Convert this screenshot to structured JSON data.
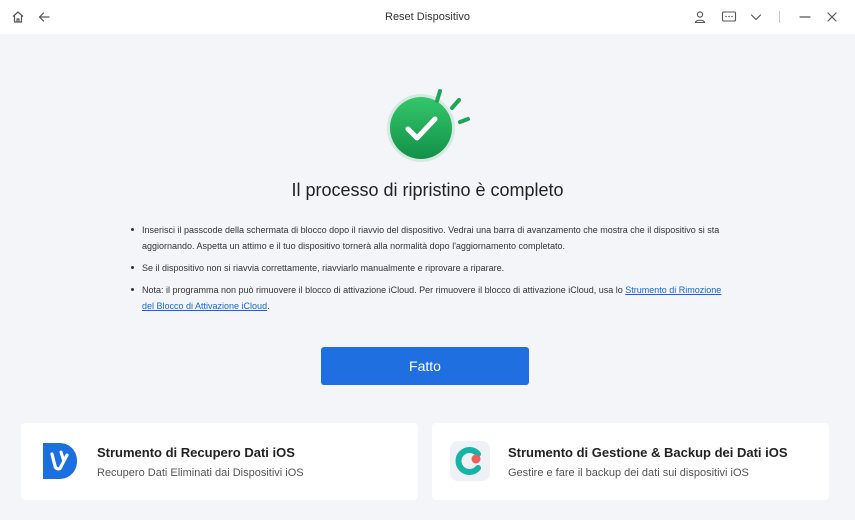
{
  "window": {
    "title": "Reset Dispositivo",
    "icons": [
      "home-icon",
      "back-arrow-icon",
      "user-icon",
      "message-icon",
      "chevron-down-icon",
      "minimize-icon",
      "close-icon"
    ]
  },
  "main": {
    "heading": "Il processo di ripristino è completo",
    "notes": [
      {
        "text": "Inserisci il passcode della schermata di blocco dopo il riavvio del dispositivo. Vedrai una barra di avanzamento che mostra che il dispositivo si sta aggiornando. Aspetta un attimo e il tuo dispositivo tornerà alla normalità dopo l'aggiornamento completato."
      },
      {
        "text": "Se il dispositivo non si riavvia correttamente, riavviarlo manualmente e riprovare a riparare."
      },
      {
        "text": "Nota: il programma non può rimuovere il blocco di attivazione iCloud. Per rimuovere il blocco di attivazione iCloud, usa lo ",
        "link": "Strumento di Rimozione del Blocco di Attivazione iCloud",
        "suffix": "."
      }
    ],
    "done_label": "Fatto"
  },
  "cards": [
    {
      "title": "Strumento di Recupero Dati iOS",
      "subtitle": "Recupero Dati Eliminati dai Dispositivi iOS",
      "icon": "data-recovery-app-icon"
    },
    {
      "title": "Strumento di Gestione & Backup dei Dati iOS",
      "subtitle": "Gestire e fare il backup dei dati sui dispositivi iOS",
      "icon": "backup-manager-app-icon"
    }
  ],
  "colors": {
    "accent": "#1f6fe0",
    "success": "#1fa55a",
    "link": "#1466d8",
    "background": "#f4f5f8"
  }
}
